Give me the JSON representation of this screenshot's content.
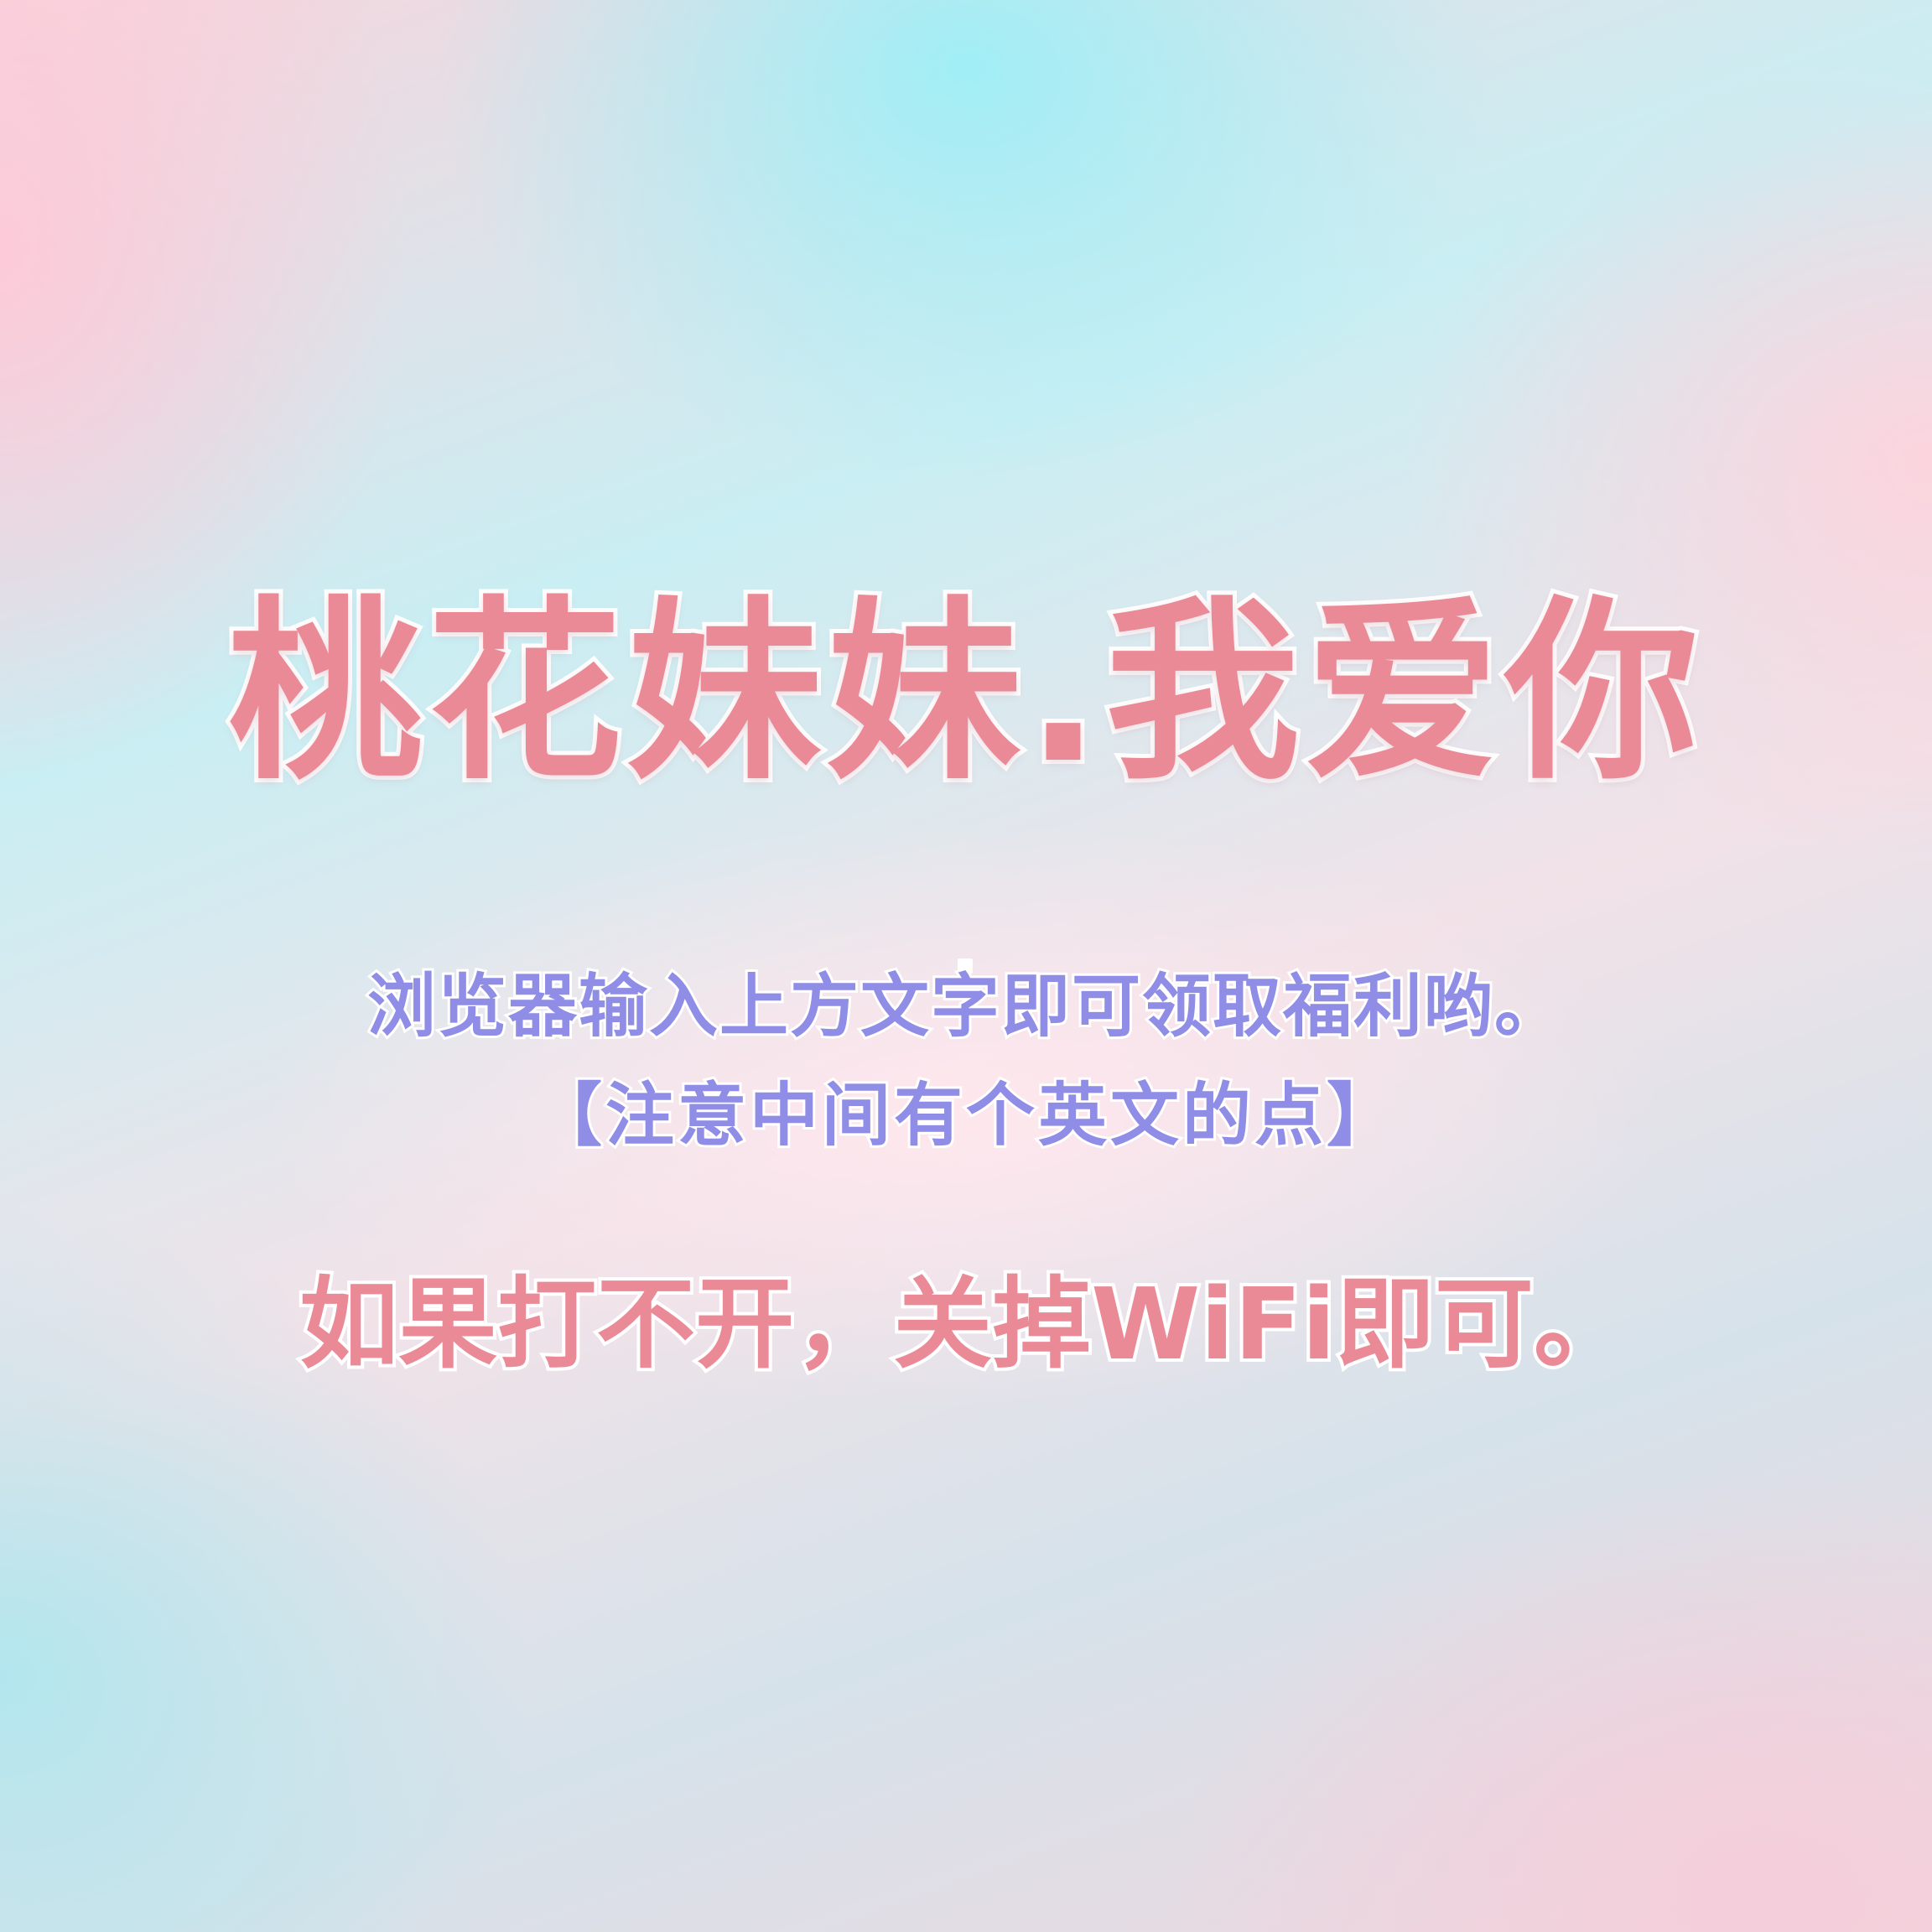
{
  "headline": "桃花妹妹.我爱你",
  "instructions": {
    "line1": "浏览器输入上方文字即可领取福利哟。",
    "line2": "【注意中间有个英文的点】"
  },
  "tip": "如果打不开，关掉WiFi即可。",
  "colors": {
    "headline": "#ea8a96",
    "instructions": "#8f8de6",
    "outline": "#ffffff"
  }
}
